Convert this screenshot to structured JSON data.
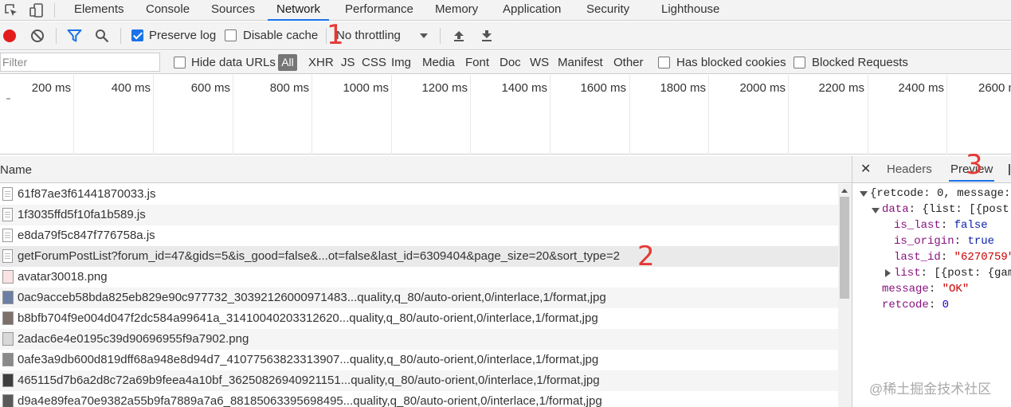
{
  "devtools_tabs": [
    "Elements",
    "Console",
    "Sources",
    "Network",
    "Performance",
    "Memory",
    "Application",
    "Security",
    "Lighthouse"
  ],
  "active_tab": "Network",
  "toolbar": {
    "preserve_log": "Preserve log",
    "disable_cache": "Disable cache",
    "throttling": "No throttling",
    "preserve_log_checked": true,
    "disable_cache_checked": false
  },
  "filter": {
    "placeholder": "Filter",
    "hide_data_urls": "Hide data URLs",
    "types": [
      "All",
      "XHR",
      "JS",
      "CSS",
      "Img",
      "Media",
      "Font",
      "Doc",
      "WS",
      "Manifest",
      "Other"
    ],
    "has_blocked_cookies": "Has blocked cookies",
    "blocked_requests": "Blocked Requests"
  },
  "overview_ticks": [
    "200 ms",
    "400 ms",
    "600 ms",
    "800 ms",
    "1000 ms",
    "1200 ms",
    "1400 ms",
    "1600 ms",
    "1800 ms",
    "2000 ms",
    "2200 ms",
    "2400 ms",
    "2600 ms"
  ],
  "list": {
    "header": "Name",
    "rows": [
      {
        "name": "61f87ae3f61441870033.js",
        "icon": "js-file-icon"
      },
      {
        "name": "1f3035ffd5f10fa1b589.js",
        "icon": "js-file-icon"
      },
      {
        "name": "e8da79f5c847f776758a.js",
        "icon": "js-file-icon"
      },
      {
        "name": "getForumPostList?forum_id=47&gids=5&is_good=false&...ot=false&last_id=6309404&page_size=20&sort_type=2",
        "icon": "xhr-file-icon"
      },
      {
        "name": "avatar30018.png",
        "icon": "image-thumbnail-icon",
        "color": "#f4c7c7"
      },
      {
        "name": "0ac9acceb58bda825eb829e90c977732_3039212600097148​3...quality,q_80/auto-orient,0/interlace,1/format,jpg",
        "icon": "image-thumbnail-icon",
        "color": "#6b7fa3"
      },
      {
        "name": "b8bfb704f9e004d047f2dc584a99641a_31410040203312620...quality,q_80/auto-orient,0/interlace,1/format,jpg",
        "icon": "image-thumbnail-icon",
        "color": "#7d6f6a"
      },
      {
        "name": "2adac6e4e0195c39d90696955f9a7902.png",
        "icon": "image-thumbnail-icon",
        "color": "#d8d8d8"
      },
      {
        "name": "0afe3a9db600d819dff68a948e8d94d7_41077563823313907...quality,q_80/auto-orient,0/interlace,1/format,jpg",
        "icon": "image-thumbnail-icon",
        "color": "#8a8a8a"
      },
      {
        "name": "465115d7b6a2d8c72a69b9feea4a10bf_36250826940921151...quality,q_80/auto-orient,0/interlace,1/format,jpg",
        "icon": "image-thumbnail-icon",
        "color": "#3e3e3e"
      },
      {
        "name": "d9a4e89fea70e9382a55b9fa7889a7a6_88185063395698495...quality,q_80/auto-orient,0/interlace,1/format,jpg",
        "icon": "image-thumbnail-icon",
        "color": "#5a5a5a"
      }
    ]
  },
  "panel": {
    "tabs": [
      "Headers",
      "Preview"
    ],
    "active": "Preview",
    "preview": {
      "root": "{retcode: 0, message:",
      "data_key": "data",
      "data_val": "{list: [{post:",
      "is_last_key": "is_last",
      "is_last_val": "false",
      "is_origin_key": "is_origin",
      "is_origin_val": "true",
      "last_id_key": "last_id",
      "last_id_val": "\"6270759\"",
      "list_key": "list",
      "list_val": "[{post: {gam",
      "message_key": "message",
      "message_val": "\"OK\"",
      "retcode_key": "retcode",
      "retcode_val": "0"
    }
  },
  "annotations": [
    "1",
    "2",
    "3"
  ],
  "watermark": "@稀土掘金技术社区",
  "colors": {
    "accent": "#1a73e8",
    "record": "#e21c1c",
    "annotation": "#e53935"
  }
}
